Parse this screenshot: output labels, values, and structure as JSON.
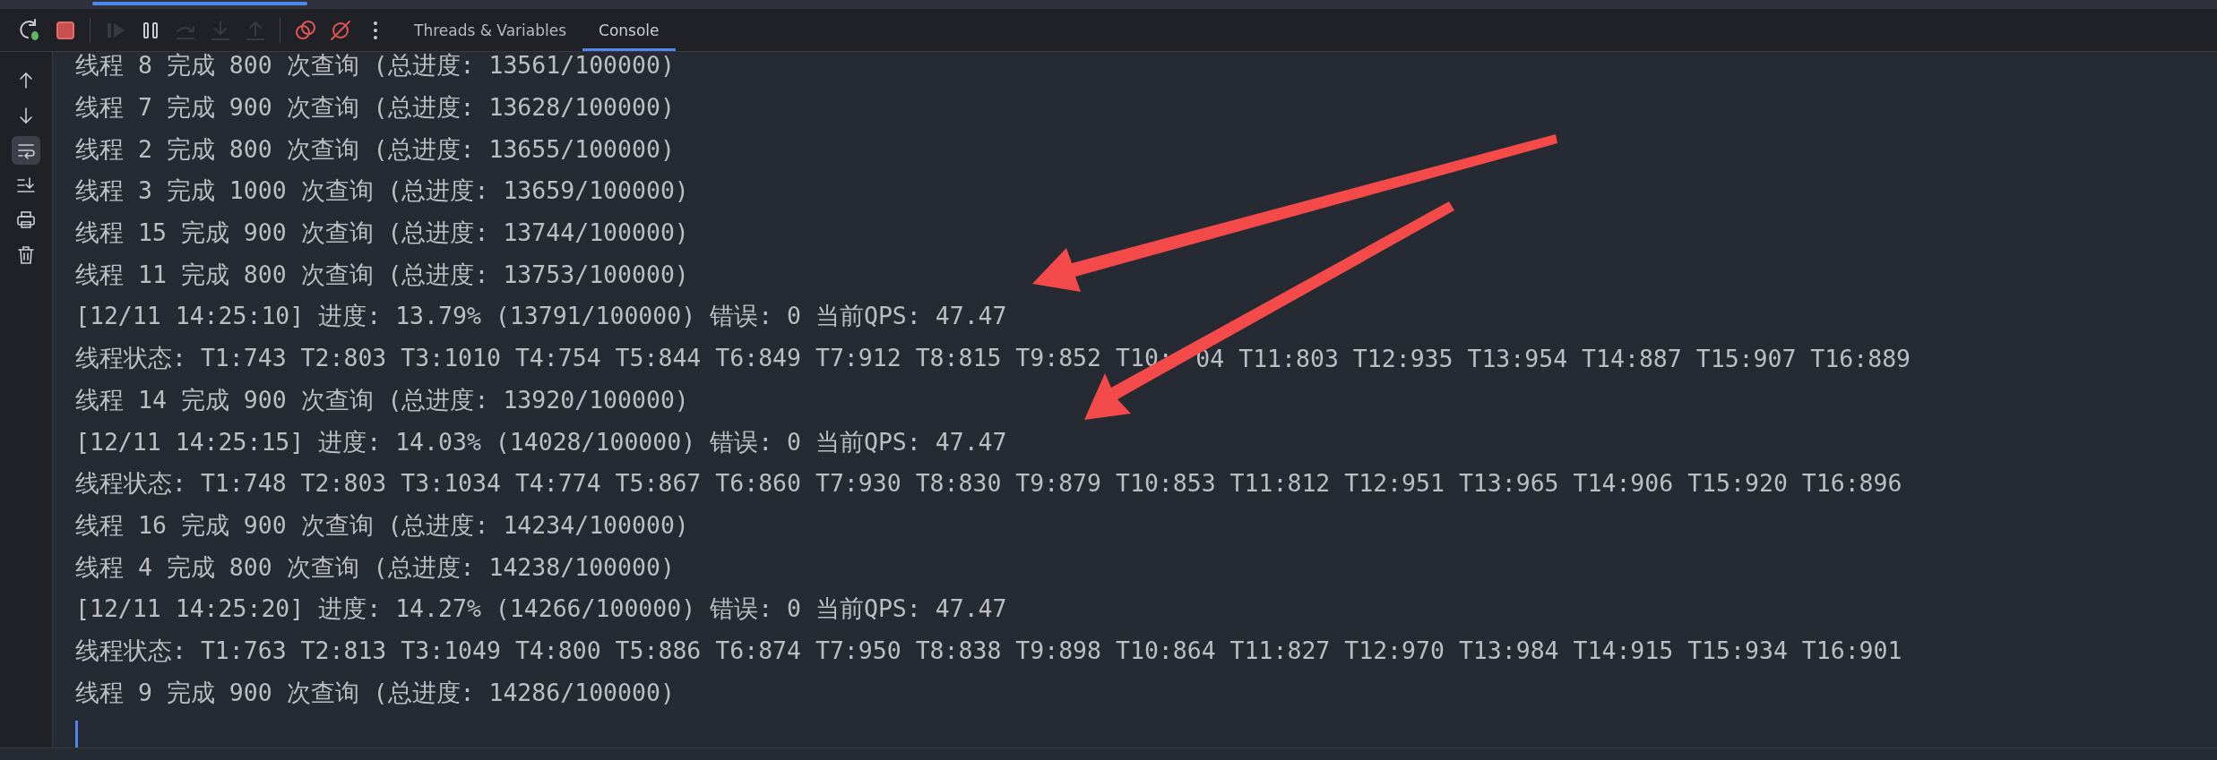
{
  "toolbar": {
    "buttons": [
      {
        "kind": "rerun",
        "disabled": false
      },
      {
        "kind": "stop",
        "disabled": false
      },
      {
        "kind": "separator"
      },
      {
        "kind": "resume",
        "disabled": true
      },
      {
        "kind": "pause",
        "disabled": false
      },
      {
        "kind": "step-over",
        "disabled": true
      },
      {
        "kind": "step-into",
        "disabled": true
      },
      {
        "kind": "step-out",
        "disabled": true
      },
      {
        "kind": "separator"
      },
      {
        "kind": "breakpoints",
        "disabled": false
      },
      {
        "kind": "mute",
        "disabled": false
      },
      {
        "kind": "more",
        "disabled": false
      }
    ],
    "tabs": [
      {
        "label": "Threads & Variables",
        "selected": false
      },
      {
        "label": "Console",
        "selected": true
      }
    ]
  },
  "sidebar": {
    "items": [
      {
        "kind": "up",
        "on": false
      },
      {
        "kind": "down",
        "on": false
      },
      {
        "kind": "wrap",
        "on": true
      },
      {
        "kind": "scroll-end",
        "on": false
      },
      {
        "kind": "print",
        "on": false
      },
      {
        "kind": "trash",
        "on": false
      }
    ]
  },
  "console": {
    "lines": [
      {
        "text": "线程 8 完成 800 次查询 (总进度: 13561/100000)"
      },
      {
        "text": "线程 7 完成 900 次查询 (总进度: 13628/100000)"
      },
      {
        "text": "线程 2 完成 800 次查询 (总进度: 13655/100000)"
      },
      {
        "text": "线程 3 完成 1000 次查询 (总进度: 13659/100000)"
      },
      {
        "text": "线程 15 完成 900 次查询 (总进度: 13744/100000)"
      },
      {
        "text": "线程 11 完成 800 次查询 (总进度: 13753/100000)"
      },
      {
        "text": "[12/11 14:25:10] 进度: 13.79% (13791/100000) 错误: 0 当前QPS: 47.47"
      },
      {
        "text": "线程状态: T1:743 T2:803 T3:1010 T4:754 T5:844 T6:849 T7:912 T8:815 T9:852 T10:",
        "continuation": "04 T11:803 T12:935 T13:954 T14:887 T15:907 T16:889"
      },
      {
        "text": "线程 14 完成 900 次查询 (总进度: 13920/100000)"
      },
      {
        "text": "[12/11 14:25:15] 进度: 14.03% (14028/100000) 错误: 0 当前QPS: 47.47"
      },
      {
        "text": "线程状态: T1:748 T2:803 T3:1034 T4:774 T5:867 T6:860 T7:930 T8:830 T9:879 T10:853 T11:812 T12:951 T13:965 T14:906 T15:920 T16:896"
      },
      {
        "text": "线程 16 完成 900 次查询 (总进度: 14234/100000)"
      },
      {
        "text": "线程 4 完成 800 次查询 (总进度: 14238/100000)"
      },
      {
        "text": "[12/11 14:25:20] 进度: 14.27% (14266/100000) 错误: 0 当前QPS: 47.47"
      },
      {
        "text": "线程状态: T1:763 T2:813 T3:1049 T4:800 T5:886 T6:874 T7:950 T8:838 T9:898 T10:864 T11:827 T12:970 T13:984 T14:915 T15:934 T16:901"
      },
      {
        "text": "线程 9 完成 900 次查询 (总进度: 14286/100000)"
      }
    ]
  }
}
